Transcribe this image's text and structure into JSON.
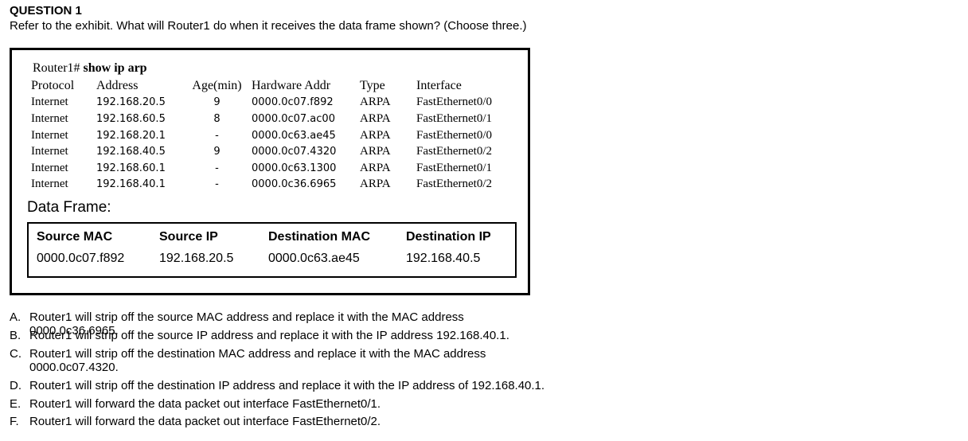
{
  "question": {
    "title": "QUESTION 1",
    "text": "Refer to the exhibit. What will Router1 do when it receives the data frame shown? (Choose three.)"
  },
  "exhibit": {
    "prompt": "Router1#",
    "command": "show ip arp",
    "headers": [
      "Protocol",
      "Address",
      "Age(min)",
      "Hardware Addr",
      "Type",
      "Interface"
    ],
    "rows": [
      [
        "Internet",
        "192.168.20.5",
        "9",
        "0000.0c07.f892",
        "ARPA",
        "FastEthernet0/0"
      ],
      [
        "Internet",
        "192.168.60.5",
        "8",
        "0000.0c07.ac00",
        "ARPA",
        "FastEthernet0/1"
      ],
      [
        "Internet",
        "192.168.20.1",
        "-",
        "0000.0c63.ae45",
        "ARPA",
        "FastEthernet0/0"
      ],
      [
        "Internet",
        "192.168.40.5",
        "9",
        "0000.0c07.4320",
        "ARPA",
        "FastEthernet0/2"
      ],
      [
        "Internet",
        "192.168.60.1",
        "-",
        "0000.0c63.1300",
        "ARPA",
        "FastEthernet0/1"
      ],
      [
        "Internet",
        "192.168.40.1",
        "-",
        "0000.0c36.6965",
        "ARPA",
        "FastEthernet0/2"
      ]
    ],
    "data_frame": {
      "label": "Data Frame:",
      "headers": [
        "Source MAC",
        "Source IP",
        "Destination MAC",
        "Destination IP"
      ],
      "values": [
        "0000.0c07.f892",
        "192.168.20.5",
        "0000.0c63.ae45",
        "192.168.40.5"
      ]
    }
  },
  "options": [
    {
      "letter": "A.",
      "text": "Router1 will strip off the source MAC address and replace it with the MAC address 0000.0c36.6965."
    },
    {
      "letter": "B.",
      "text": "Router1 will strip off the source IP address and replace it with the IP address 192.168.40.1."
    },
    {
      "letter": "C.",
      "text": "Router1 will strip off the destination MAC address and replace it with the MAC address 0000.0c07.4320."
    },
    {
      "letter": "D.",
      "text": "Router1 will strip off the destination IP address and replace it with the IP address of 192.168.40.1."
    },
    {
      "letter": "E.",
      "text": "Router1 will forward the data packet out interface FastEthernet0/1."
    },
    {
      "letter": "F.",
      "text": "Router1 will forward the data packet out interface FastEthernet0/2."
    }
  ]
}
